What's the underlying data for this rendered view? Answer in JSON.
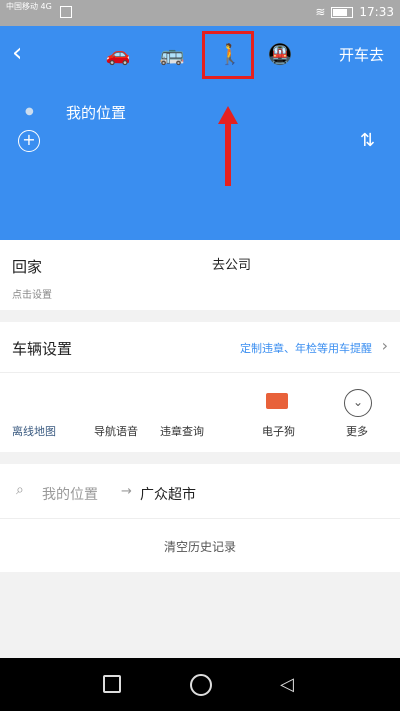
{
  "status_bar": {
    "carrier": "中国移动 4G",
    "time": "17:33"
  },
  "header": {
    "back_glyph": "‹",
    "modes": [
      {
        "name": "drive",
        "icon": "car-icon"
      },
      {
        "name": "bus",
        "icon": "bus-icon"
      },
      {
        "name": "walk",
        "icon": "walk-icon",
        "selected": true
      },
      {
        "name": "metro",
        "icon": "metro-icon"
      }
    ],
    "go_button": "开车去",
    "my_location": "我的位置"
  },
  "home": {
    "label": "回家",
    "subtext": "点击设置",
    "company": "去公司"
  },
  "vehicle": {
    "title": "车辆设置",
    "link": "定制违章、年检等用车提醒"
  },
  "tools": [
    "离线地图",
    "导航语音",
    "违章查询",
    "电子狗",
    "更多"
  ],
  "history": {
    "from": "我的位置",
    "arrow": "→",
    "to": "广众超市",
    "clear": "清空历史记录"
  },
  "colors": {
    "primary": "#3a8ef0",
    "highlight": "#e52020"
  }
}
